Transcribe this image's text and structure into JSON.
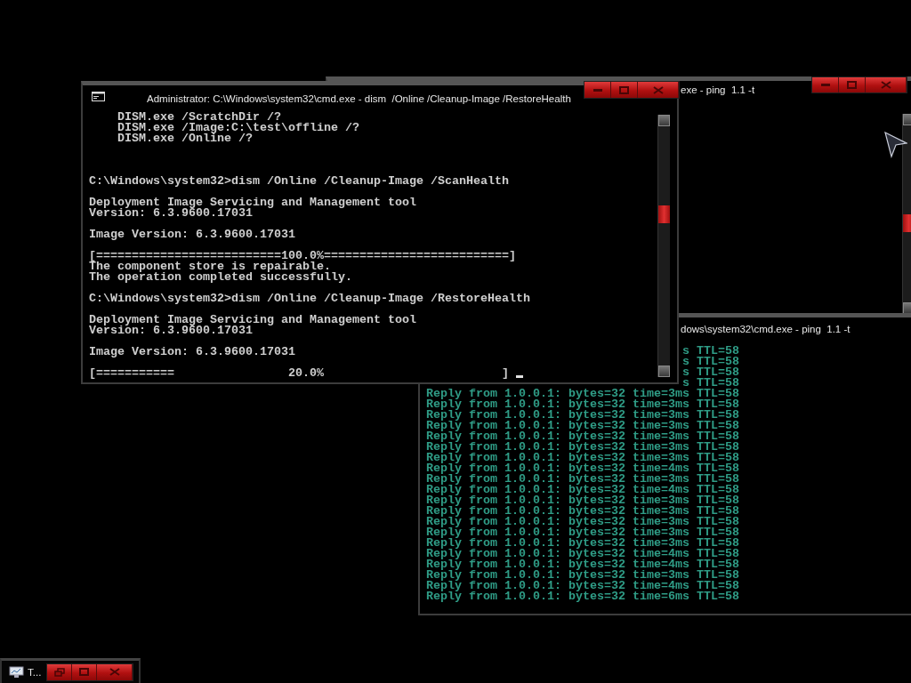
{
  "desktop": {
    "windows": [
      {
        "kind": "console",
        "title": "exe - ping  1.1 -t",
        "scrollbar": true
      },
      {
        "kind": "console",
        "title": "dows\\system32\\cmd.exe - ping  1.1 -t",
        "lines": [
          {
            "kind": "partial",
            "text": "s TTL=58"
          },
          {
            "kind": "partial",
            "text": "s TTL=58"
          },
          {
            "kind": "partial",
            "text": "s TTL=58"
          },
          {
            "kind": "partial",
            "text": "s TTL=58"
          },
          {
            "kind": "text",
            "text": "Reply from 1.0.0.1: bytes=32 time=3ms TTL=58"
          },
          {
            "kind": "text",
            "text": "Reply from 1.0.0.1: bytes=32 time=3ms TTL=58"
          },
          {
            "kind": "text",
            "text": "Reply from 1.0.0.1: bytes=32 time=3ms TTL=58"
          },
          {
            "kind": "text",
            "text": "Reply from 1.0.0.1: bytes=32 time=3ms TTL=58"
          },
          {
            "kind": "text",
            "text": "Reply from 1.0.0.1: bytes=32 time=3ms TTL=58"
          },
          {
            "kind": "text",
            "text": "Reply from 1.0.0.1: bytes=32 time=3ms TTL=58"
          },
          {
            "kind": "text",
            "text": "Reply from 1.0.0.1: bytes=32 time=3ms TTL=58"
          },
          {
            "kind": "text",
            "text": "Reply from 1.0.0.1: bytes=32 time=4ms TTL=58"
          },
          {
            "kind": "text",
            "text": "Reply from 1.0.0.1: bytes=32 time=3ms TTL=58"
          },
          {
            "kind": "text",
            "text": "Reply from 1.0.0.1: bytes=32 time=4ms TTL=58"
          },
          {
            "kind": "text",
            "text": "Reply from 1.0.0.1: bytes=32 time=3ms TTL=58"
          },
          {
            "kind": "text",
            "text": "Reply from 1.0.0.1: bytes=32 time=3ms TTL=58"
          },
          {
            "kind": "text",
            "text": "Reply from 1.0.0.1: bytes=32 time=3ms TTL=58"
          },
          {
            "kind": "text",
            "text": "Reply from 1.0.0.1: bytes=32 time=3ms TTL=58"
          },
          {
            "kind": "text",
            "text": "Reply from 1.0.0.1: bytes=32 time=3ms TTL=58"
          },
          {
            "kind": "text",
            "text": "Reply from 1.0.0.1: bytes=32 time=4ms TTL=58"
          },
          {
            "kind": "text",
            "text": "Reply from 1.0.0.1: bytes=32 time=4ms TTL=58"
          },
          {
            "kind": "text",
            "text": "Reply from 1.0.0.1: bytes=32 time=3ms TTL=58"
          },
          {
            "kind": "text",
            "text": "Reply from 1.0.0.1: bytes=32 time=4ms TTL=58"
          },
          {
            "kind": "text",
            "text": "Reply from 1.0.0.1: bytes=32 time=6ms TTL=58"
          }
        ]
      },
      {
        "kind": "console",
        "title": "Administrator: C:\\Windows\\system32\\cmd.exe - dism  /Online /Cleanup-Image /RestoreHealth",
        "scrollbar": true,
        "cursor": true,
        "lines": [
          {
            "kind": "text",
            "text": "    DISM.exe /ScratchDir /?"
          },
          {
            "kind": "text",
            "text": "    DISM.exe /Image:C:\\test\\offline /?"
          },
          {
            "kind": "text",
            "text": "    DISM.exe /Online /?"
          },
          {
            "kind": "blank"
          },
          {
            "kind": "blank"
          },
          {
            "kind": "blank"
          },
          {
            "kind": "text",
            "text": "C:\\Windows\\system32>dism /Online /Cleanup-Image /ScanHealth"
          },
          {
            "kind": "blank"
          },
          {
            "kind": "text",
            "text": "Deployment Image Servicing and Management tool"
          },
          {
            "kind": "text",
            "text": "Version: 6.3.9600.17031"
          },
          {
            "kind": "blank"
          },
          {
            "kind": "text",
            "text": "Image Version: 6.3.9600.17031"
          },
          {
            "kind": "blank"
          },
          {
            "kind": "text",
            "text": "[==========================100.0%==========================]"
          },
          {
            "kind": "text",
            "text": "The component store is repairable."
          },
          {
            "kind": "text",
            "text": "The operation completed successfully."
          },
          {
            "kind": "blank"
          },
          {
            "kind": "text",
            "text": "C:\\Windows\\system32>dism /Online /Cleanup-Image /RestoreHealth"
          },
          {
            "kind": "blank"
          },
          {
            "kind": "text",
            "text": "Deployment Image Servicing and Management tool"
          },
          {
            "kind": "text",
            "text": "Version: 6.3.9600.17031"
          },
          {
            "kind": "blank"
          },
          {
            "kind": "text",
            "text": "Image Version: 6.3.9600.17031"
          },
          {
            "kind": "blank"
          },
          {
            "kind": "text",
            "text": "[===========                20.0%                         ]"
          }
        ]
      },
      {
        "kind": "minimized",
        "title": "T..."
      }
    ]
  }
}
